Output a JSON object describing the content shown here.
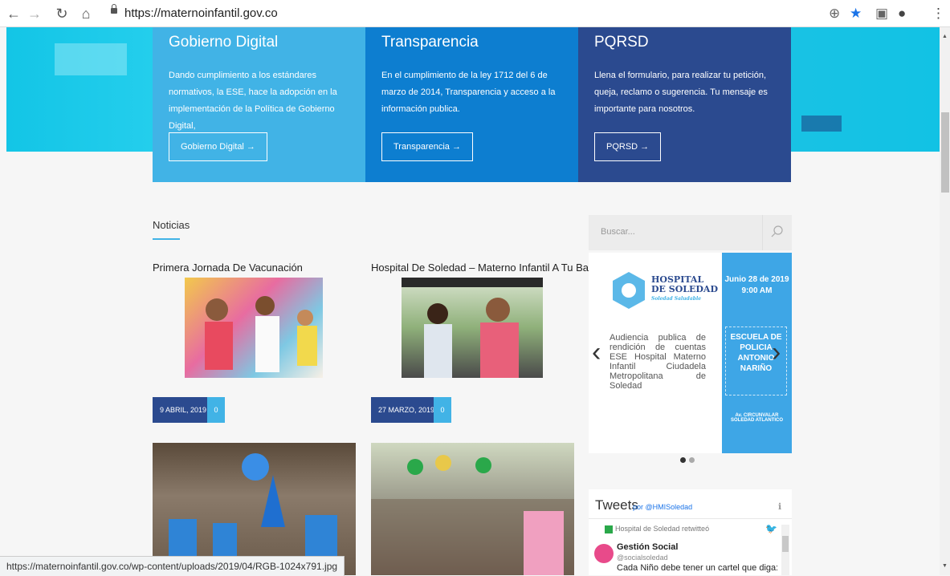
{
  "browser": {
    "url": "https://maternoinfantil.gov.co",
    "status_url": "https://maternoinfantil.gov.co/wp-content/uploads/2019/04/RGB-1024x791.jpg"
  },
  "cards": [
    {
      "title": "Gobierno Digital",
      "text": "Dando cumplimiento a los estándares normativos, la ESE, hace la adopción en la implementación de la Política de Gobierno Digital,",
      "button": "Gobierno Digital →",
      "color": "#41b3e6"
    },
    {
      "title": "Transparencia",
      "text": "En el cumplimiento de la ley 1712 del 6 de marzo de 2014, Transparencia y acceso a la información publica.",
      "button": "Transparencia →",
      "color": "#0d7ed0"
    },
    {
      "title": "PQRSD",
      "text": "Llena el formulario, para realizar tu petición, queja, reclamo o sugerencia. Tu mensaje es importante para nosotros.",
      "button": "PQRSD →",
      "color": "#2b4a8f"
    }
  ],
  "news": {
    "heading": "Noticias",
    "posts": [
      {
        "title": "Primera Jornada De Vacunación",
        "date": "9 ABRIL, 2019",
        "comments": "0"
      },
      {
        "title": "Hospital De Soledad – Materno Infantil A Tu Barrio",
        "date": "27 MARZO, 2019",
        "comments": "0"
      }
    ]
  },
  "sidebar": {
    "search_placeholder": "Buscar...",
    "slide": {
      "logo_line1": "HOSPITAL",
      "logo_line2": "DE SOLEDAD",
      "logo_sub": "Soledad Saludable",
      "text": "Audiencia publica de rendición de cuentas ESE Hospital Materno Infantil Ciudadela Metropolitana de Soledad",
      "date": "Junio 28 de 2019",
      "time": "9:00 AM",
      "place": "ESCUELA DE POLICIA ANTONIO NARIÑO",
      "address": "Av. CIRCUNVALAR SOLEDAD ATLANTICO"
    },
    "tweets": {
      "title": "Tweets",
      "by": "por @HMISoledad",
      "retweet": "Hospital de Soledad retwitteó",
      "author": "Gestión Social",
      "handle": "@socialsoledad",
      "text": "Cada Niño debe tener un cartel que diga: \"Tratar"
    }
  },
  "colors": {
    "accent": "#41b3e6",
    "navy": "#2b4a8f",
    "blue": "#0d7ed0",
    "hero": "#22cbe9"
  }
}
